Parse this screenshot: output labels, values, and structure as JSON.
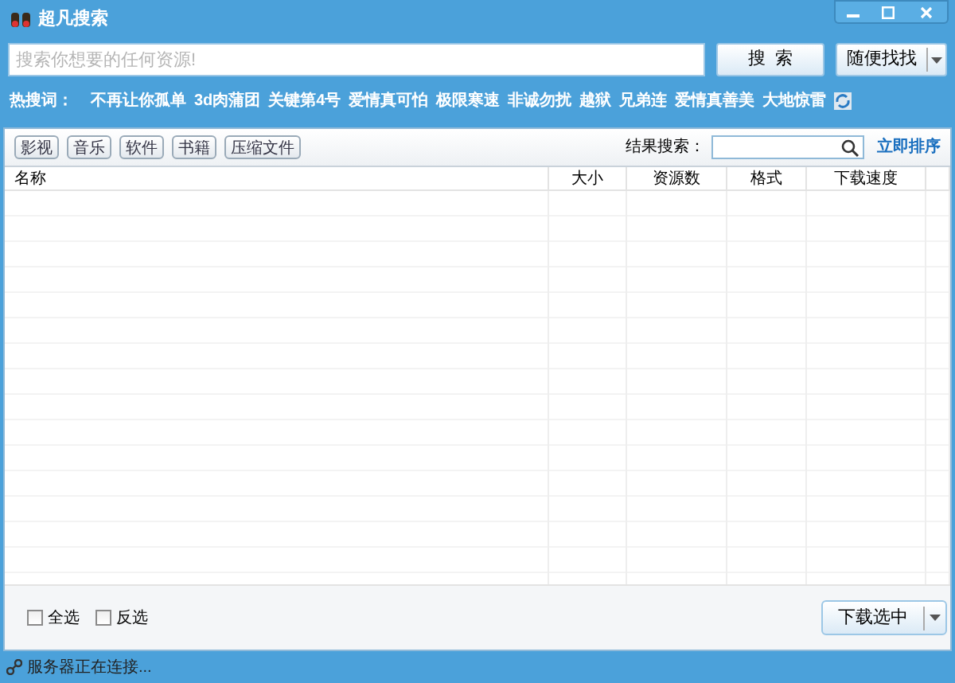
{
  "window": {
    "title": "超凡搜索"
  },
  "search": {
    "placeholder": "搜索你想要的任何资源!",
    "search_button": "搜  索",
    "random_button": "随便找找"
  },
  "hot_words": {
    "label": "热搜词：",
    "items": [
      "不再让你孤单",
      "3d肉蒲团",
      "关键第4号",
      "爱情真可怕",
      "极限寒速",
      "非诚勿扰",
      "越狱",
      "兄弟连",
      "爱情真善美",
      "大地惊雷"
    ]
  },
  "categories": [
    "影视",
    "音乐",
    "软件",
    "书籍",
    "压缩文件"
  ],
  "result_search": {
    "label": "结果搜索：",
    "sort_link": "立即排序"
  },
  "table": {
    "columns": [
      "名称",
      "大小",
      "资源数",
      "格式",
      "下载速度"
    ]
  },
  "footer": {
    "checkboxes": [
      {
        "label": "全选",
        "checked": false
      },
      {
        "label": "反选",
        "checked": false
      }
    ],
    "download_button": "下载选中"
  },
  "status_bar": "服务器正在连接..."
}
